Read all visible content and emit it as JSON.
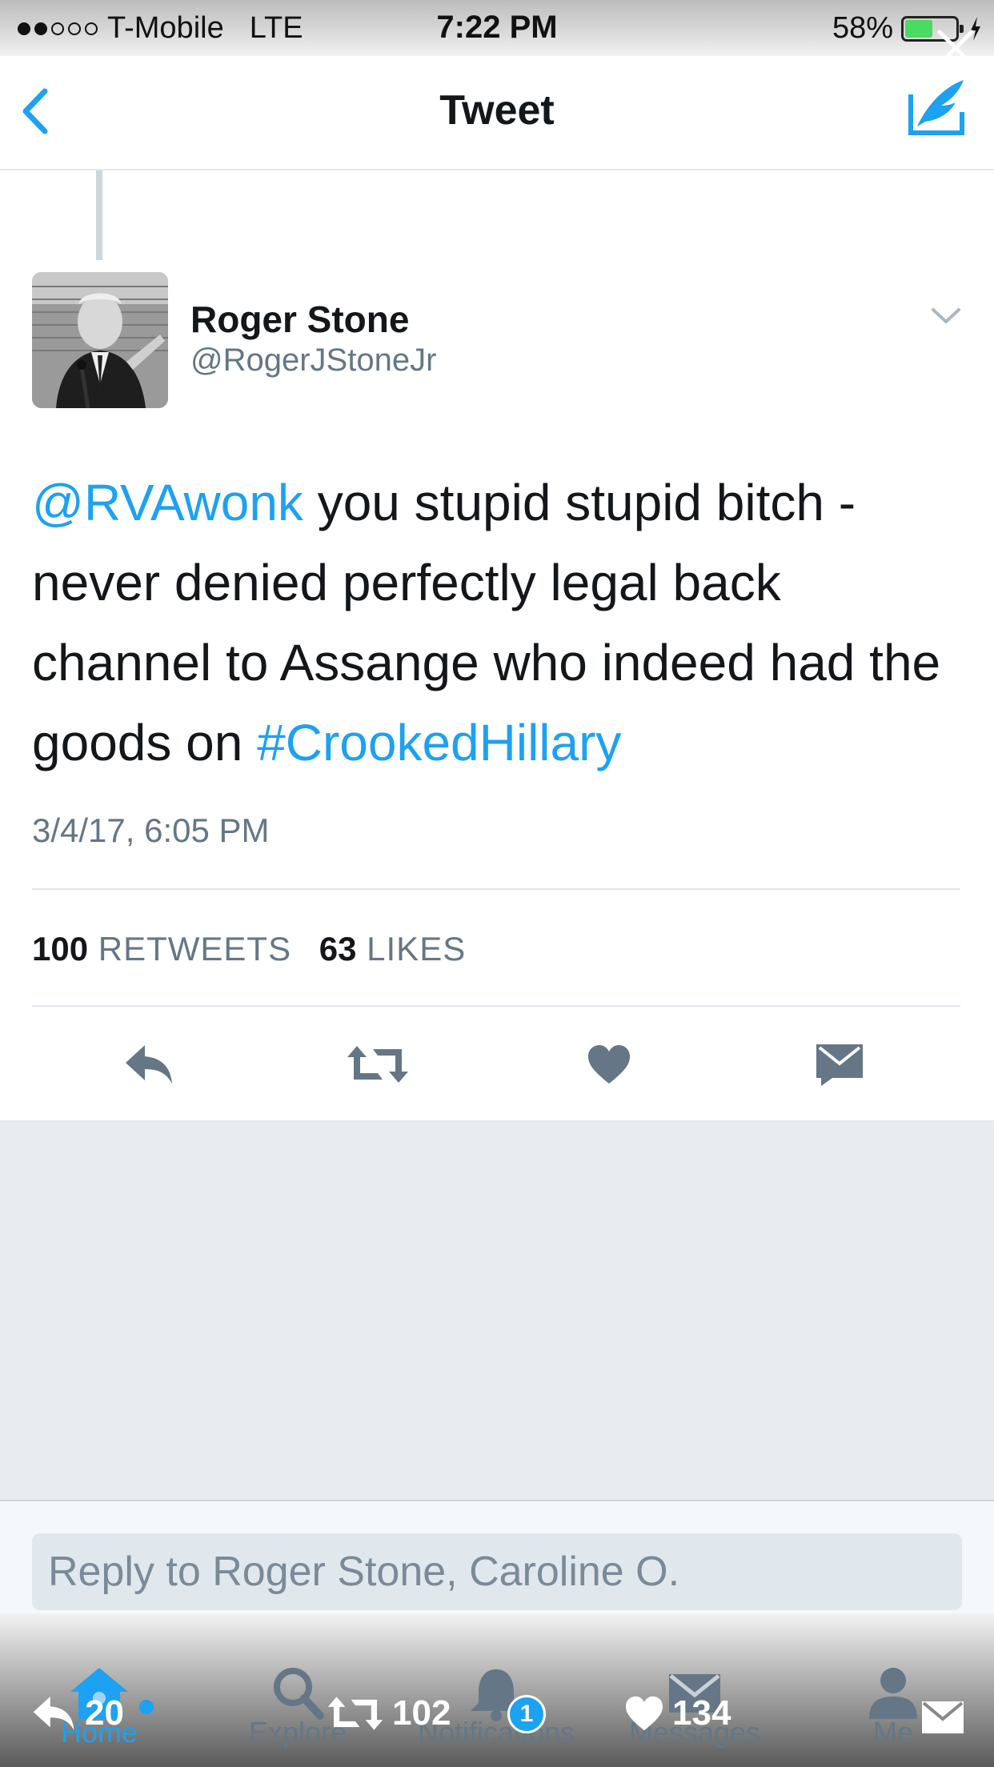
{
  "status_bar": {
    "carrier": "T-Mobile",
    "network": "LTE",
    "time": "7:22 PM",
    "battery": "58%",
    "battery_level": 0.58
  },
  "nav": {
    "title": "Tweet"
  },
  "tweet": {
    "author_name": "Roger Stone",
    "author_handle": "@RogerJStoneJr",
    "mention": "@RVAwonk",
    "text_main": " you stupid stupid bitch - never denied perfectly legal back channel to Assange who indeed had the goods on ",
    "hashtag": "#CrookedHillary",
    "date": "3/4/17, 6:05 PM",
    "retweet_count": "100",
    "retweet_label": "RETWEETS",
    "like_count": "63",
    "like_label": "LIKES"
  },
  "reply": {
    "placeholder": "Reply to Roger Stone, Caroline O."
  },
  "tabbar": {
    "tabs": [
      {
        "label": "Home",
        "icon": "home-icon"
      },
      {
        "label": "Explore",
        "icon": "search-icon"
      },
      {
        "label": "Notifications",
        "icon": "bell-icon"
      },
      {
        "label": "Messages",
        "icon": "envelope-icon"
      },
      {
        "label": "Me",
        "icon": "person-icon"
      }
    ],
    "notifications_badge": "1"
  },
  "overlay_actions": {
    "reply_count": "20",
    "retweet_count": "102",
    "like_count": "134"
  },
  "colors": {
    "accent": "#1da1f2",
    "text": "#14171a",
    "secondary": "#657786",
    "background_gray": "#e6ecf0"
  }
}
